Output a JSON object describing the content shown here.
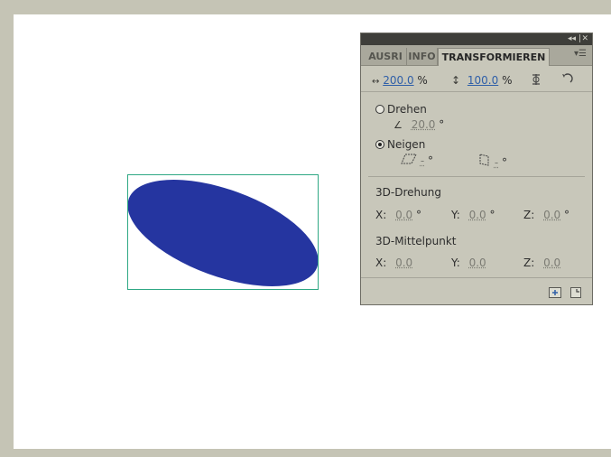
{
  "panel": {
    "tabs": [
      {
        "label": "AUSRI"
      },
      {
        "label": "INFO"
      },
      {
        "label": "TRANSFORMIEREN"
      }
    ],
    "width_value": "200.0",
    "height_value": "100.0",
    "unit_percent": "%",
    "drehen_label": "Drehen",
    "rotate_value": "20.0",
    "neigen_label": "Neigen",
    "skew_h_value": "-",
    "skew_v_value": "-",
    "degree": "°",
    "rotation3d_label": "3D-Drehung",
    "mittelpunkt_label": "3D-Mittelpunkt",
    "x_label": "X:",
    "y_label": "Y:",
    "z_label": "Z:",
    "rot3d_x": "0.0",
    "rot3d_y": "0.0",
    "rot3d_z": "0.0",
    "mp_x": "0.0",
    "mp_y": "0.0",
    "mp_z": "0.0"
  },
  "colors": {
    "shape_fill": "#2535a0",
    "selection": "#2fa884",
    "link": "#2f5fa8"
  },
  "icons": [
    "width-icon",
    "height-icon",
    "constrain-icon",
    "reset-icon",
    "rotate-icon",
    "skew-h-icon",
    "skew-v-icon",
    "duplicate-transform-icon",
    "remove-transform-icon",
    "panel-menu-icon",
    "collapse-icon",
    "close-icon"
  ]
}
